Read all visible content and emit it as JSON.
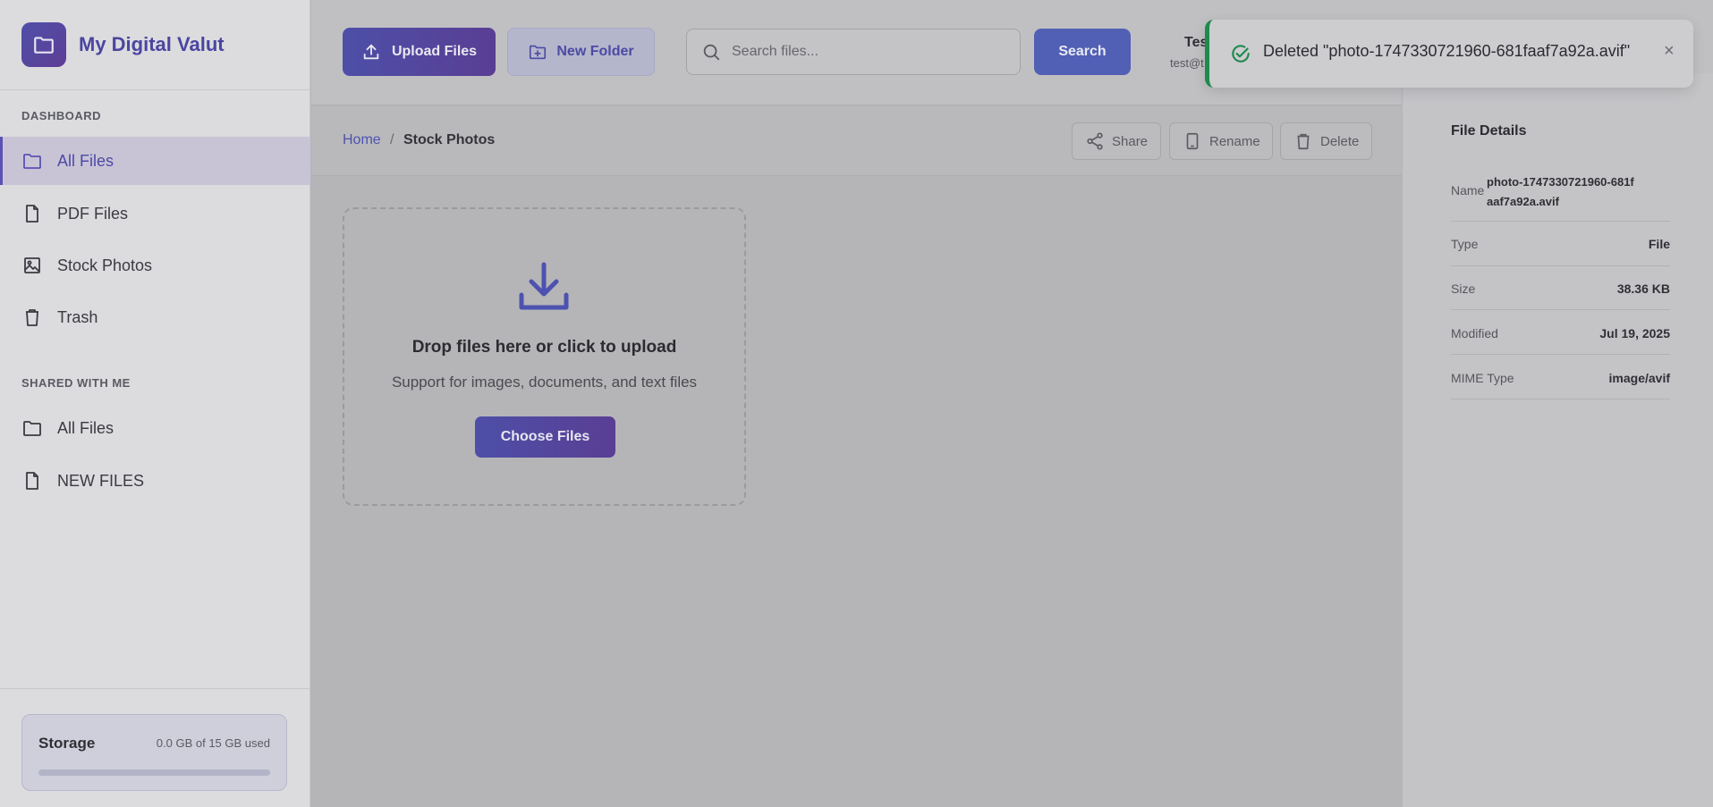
{
  "brand": {
    "title": "My Digital Valut"
  },
  "sidebar": {
    "dashboard_label": "DASHBOARD",
    "items": [
      {
        "label": "All Files",
        "icon": "folder-icon"
      },
      {
        "label": "PDF Files",
        "icon": "file-icon"
      },
      {
        "label": "Stock Photos",
        "icon": "image-icon"
      },
      {
        "label": "Trash",
        "icon": "trash-icon"
      }
    ],
    "shared_label": "SHARED WITH ME",
    "shared_items": [
      {
        "label": "All Files",
        "icon": "folder-icon"
      },
      {
        "label": "NEW FILES",
        "icon": "file-icon"
      }
    ],
    "storage": {
      "title": "Storage",
      "used": "0.0 GB of 15 GB used",
      "fraction": 0.0
    }
  },
  "header": {
    "upload_label": "Upload Files",
    "new_folder_label": "New Folder",
    "search_placeholder": "Search files...",
    "search_button": "Search",
    "user_name": "Tes",
    "user_email": "test@t"
  },
  "breadcrumb": {
    "home": "Home",
    "separator": "/",
    "current": "Stock Photos"
  },
  "actions": {
    "share": "Share",
    "rename": "Rename",
    "delete": "Delete"
  },
  "dropzone": {
    "title": "Drop files here or click to upload",
    "subtitle": "Support for images, documents, and text files",
    "button": "Choose Files"
  },
  "details": {
    "title": "File Details",
    "rows": [
      {
        "key": "Name",
        "value": "photo-1747330721960-681faaf7a92a.avif"
      },
      {
        "key": "Type",
        "value": "File"
      },
      {
        "key": "Size",
        "value": "38.36 KB"
      },
      {
        "key": "Modified",
        "value": "Jul 19, 2025"
      },
      {
        "key": "MIME Type",
        "value": "image/avif"
      }
    ]
  },
  "toast": {
    "message": "Deleted \"photo-1747330721960-681faaf7a92a.avif\"",
    "close": "×"
  },
  "colors": {
    "accent": "#4e4aa6",
    "success": "#1e8a4c",
    "primary_button": "#5160b4"
  }
}
